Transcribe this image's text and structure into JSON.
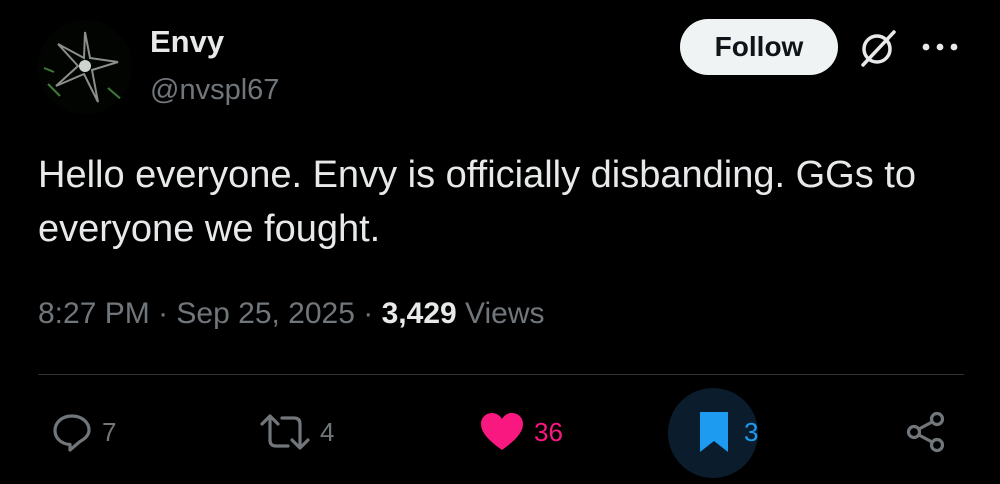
{
  "author": {
    "display_name": "Envy",
    "handle": "@nvspl67"
  },
  "header": {
    "follow_label": "Follow"
  },
  "tweet": {
    "text": "Hello everyone. Envy is officially disbanding. GGs to everyone we fought.",
    "time": "8:27 PM",
    "separator": "·",
    "date": "Sep 25, 2025",
    "views_count": "3,429",
    "views_label": "Views"
  },
  "actions": {
    "replies": "7",
    "reposts": "4",
    "likes": "36",
    "bookmarks": "3"
  },
  "icons": [
    "avatar",
    "grok-icon",
    "more-icon",
    "reply-icon",
    "repost-icon",
    "like-icon",
    "bookmark-icon",
    "share-icon"
  ],
  "colors": {
    "background": "#000000",
    "text_primary": "#e7e9ea",
    "text_secondary": "#71767b",
    "like": "#f91880",
    "bookmark": "#1d9bf0",
    "follow_bg": "#eff3f4",
    "divider": "#2f3336"
  }
}
